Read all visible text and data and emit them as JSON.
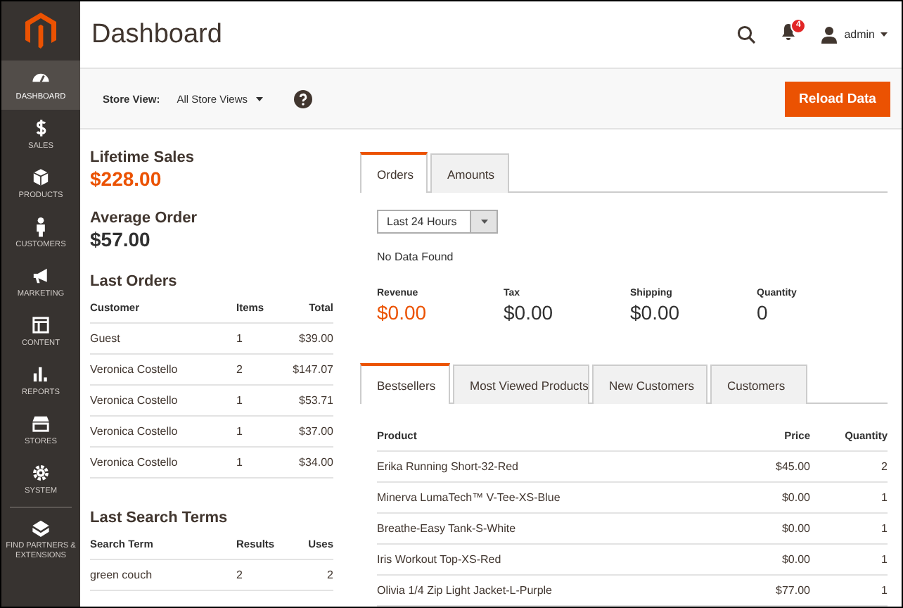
{
  "sidebar": {
    "items": [
      {
        "label": "DASHBOARD",
        "selected": true
      },
      {
        "label": "SALES",
        "selected": false
      },
      {
        "label": "PRODUCTS",
        "selected": false
      },
      {
        "label": "CUSTOMERS",
        "selected": false
      },
      {
        "label": "MARKETING",
        "selected": false
      },
      {
        "label": "CONTENT",
        "selected": false
      },
      {
        "label": "REPORTS",
        "selected": false
      },
      {
        "label": "STORES",
        "selected": false
      },
      {
        "label": "SYSTEM",
        "selected": false
      },
      {
        "label": "FIND PARTNERS & EXTENSIONS",
        "selected": false
      }
    ]
  },
  "header": {
    "title": "Dashboard",
    "notifications": "4",
    "user": "admin"
  },
  "store_bar": {
    "label": "Store View:",
    "value": "All Store Views",
    "button": "Reload Data"
  },
  "lifetime_sales": {
    "label": "Lifetime Sales",
    "value": "$228.00",
    "highlight": true
  },
  "average_order": {
    "label": "Average Order",
    "value": "$57.00",
    "highlight": false
  },
  "last_orders": {
    "title": "Last Orders",
    "columns": [
      "Customer",
      "Items",
      "Total"
    ],
    "rows": [
      [
        "Guest",
        "1",
        "$39.00"
      ],
      [
        "Veronica Costello",
        "2",
        "$147.07"
      ],
      [
        "Veronica Costello",
        "1",
        "$53.71"
      ],
      [
        "Veronica Costello",
        "1",
        "$37.00"
      ],
      [
        "Veronica Costello",
        "1",
        "$34.00"
      ]
    ]
  },
  "last_search_terms": {
    "title": "Last Search Terms",
    "columns": [
      "Search Term",
      "Results",
      "Uses"
    ],
    "rows": [
      [
        "green couch",
        "2",
        "2"
      ]
    ]
  },
  "chart_tabs": [
    {
      "label": "Orders",
      "selected": true
    },
    {
      "label": "Amounts",
      "selected": false
    }
  ],
  "period": {
    "value": "Last 24 Hours"
  },
  "no_data": "No Data Found",
  "totals": [
    {
      "label": "Revenue",
      "value": "$0.00",
      "highlight": true
    },
    {
      "label": "Tax",
      "value": "$0.00",
      "highlight": false
    },
    {
      "label": "Shipping",
      "value": "$0.00",
      "highlight": false
    },
    {
      "label": "Quantity",
      "value": "0",
      "highlight": false
    }
  ],
  "grid_tabs": [
    {
      "label": "Bestsellers",
      "selected": true
    },
    {
      "label": "Most Viewed Products",
      "selected": false
    },
    {
      "label": "New Customers",
      "selected": false
    },
    {
      "label": "Customers",
      "selected": false
    }
  ],
  "bestsellers": {
    "columns": [
      "Product",
      "Price",
      "Quantity"
    ],
    "rows": [
      [
        "Erika Running Short-32-Red",
        "$45.00",
        "2"
      ],
      [
        "Minerva LumaTech™ V-Tee-XS-Blue",
        "$0.00",
        "1"
      ],
      [
        "Breathe-Easy Tank-S-White",
        "$0.00",
        "1"
      ],
      [
        "Iris Workout Top-XS-Red",
        "$0.00",
        "1"
      ],
      [
        "Olivia 1/4 Zip Light Jacket-L-Purple",
        "$77.00",
        "1"
      ]
    ]
  }
}
